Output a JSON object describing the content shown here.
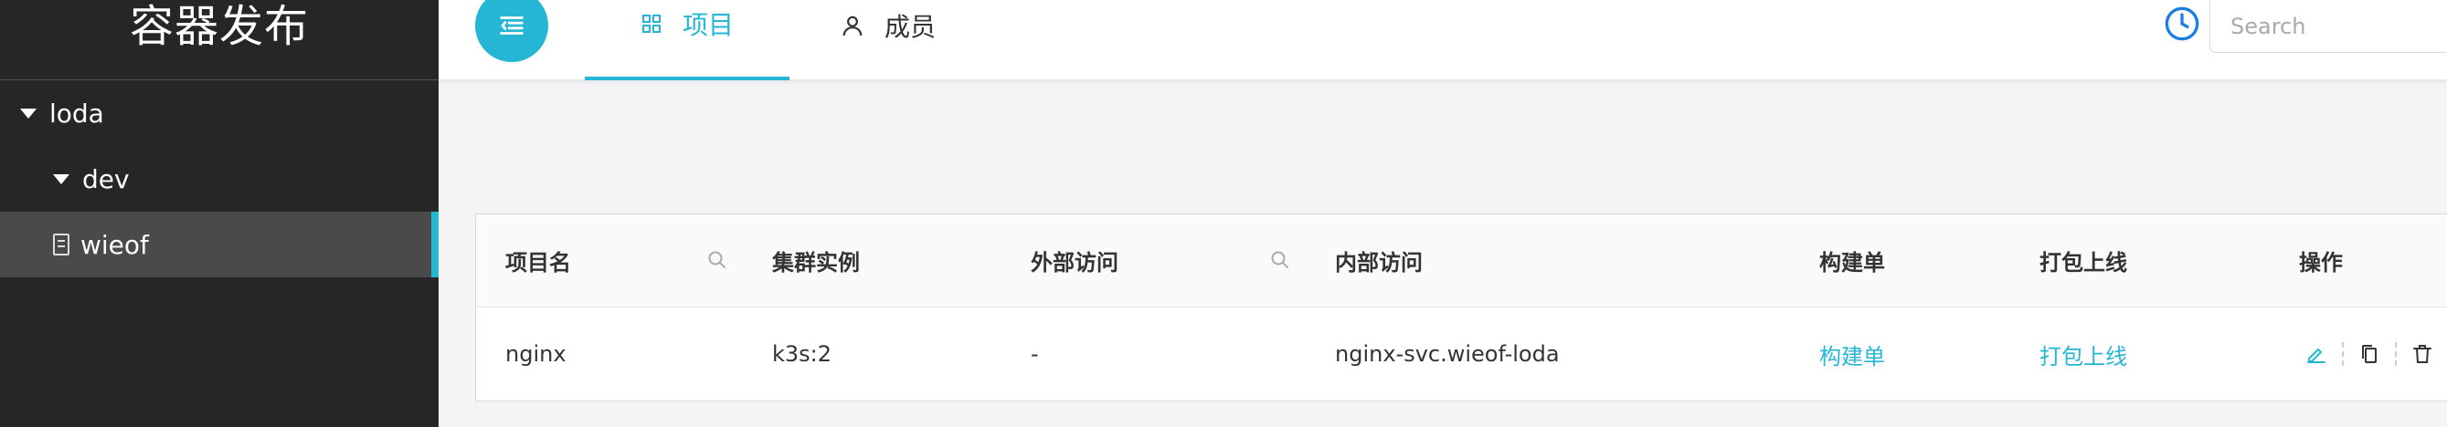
{
  "app": {
    "title": "容器发布"
  },
  "sidebar": {
    "tree": [
      {
        "label": "loda"
      },
      {
        "label": "dev"
      },
      {
        "label": "wieof"
      }
    ]
  },
  "header": {
    "tabs": [
      {
        "label": "项目",
        "icon": "grid-icon",
        "active": true
      },
      {
        "label": "成员",
        "icon": "user-icon",
        "active": false
      }
    ],
    "search": {
      "placeholder": "Search"
    }
  },
  "table": {
    "columns": [
      "项目名",
      "集群实例",
      "外部访问",
      "内部访问",
      "构建单",
      "打包上线",
      "操作"
    ],
    "rows": [
      {
        "name": "nginx",
        "cluster": "k3s:2",
        "external": "-",
        "internal": "nginx-svc.wieof-loda",
        "build": "构建单",
        "deploy": "打包上线"
      }
    ]
  },
  "colors": {
    "accent": "#25b6d6",
    "sidebar_bg": "#262626",
    "sidebar_active": "#4a4a4a"
  }
}
